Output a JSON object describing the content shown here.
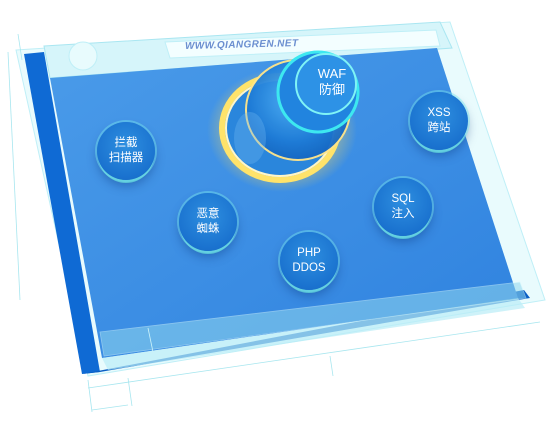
{
  "browser": {
    "url": "WWW.QIANGREN.NET"
  },
  "waf": {
    "line1": "WAF",
    "line2": "防御"
  },
  "threats": [
    {
      "id": "interception-scanner",
      "line1": "拦截",
      "line2": "扫描器"
    },
    {
      "id": "xss-crosssite",
      "line1": "XSS",
      "line2": "跨站"
    },
    {
      "id": "malicious-spider",
      "line1": "恶意",
      "line2": "蜘蛛"
    },
    {
      "id": "sql-injection",
      "line1": "SQL",
      "line2": "注入"
    },
    {
      "id": "php-ddos",
      "line1": "PHP",
      "line2": "DDOS"
    }
  ],
  "colors": {
    "screen_blue": "#3d8ee6",
    "frame_blue": "#0f6ad4",
    "glass_cyan": "#bfeff7",
    "glow_yellow": "#ffe98a",
    "ring_cyan": "#3de8f0"
  },
  "icons": {
    "window-control": "circle-icon"
  }
}
